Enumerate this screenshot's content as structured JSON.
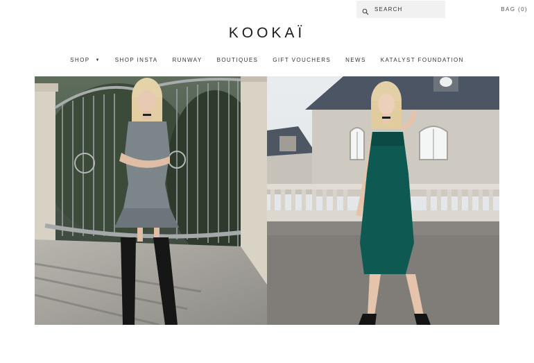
{
  "header": {
    "search_placeholder": "SEARCH",
    "bag_label": "BAG (0)",
    "logo_text": "KOOKAÏ"
  },
  "nav": {
    "items": [
      {
        "label": "SHOP"
      },
      {
        "label": "SHOP INSTA"
      },
      {
        "label": "RUNWAY"
      },
      {
        "label": "BOUTIQUES"
      },
      {
        "label": "GIFT VOUCHERS"
      },
      {
        "label": "NEWS"
      },
      {
        "label": "KATALYST FOUNDATION"
      }
    ],
    "shop_caret": "▼"
  },
  "colors": {
    "search_bg": "#f1f1f1",
    "text": "#333333",
    "dress_green": "#0e5a52",
    "dress_grey": "#7c858a"
  },
  "icons": {
    "search": "search-icon",
    "shop_dropdown": "caret-down-icon"
  }
}
